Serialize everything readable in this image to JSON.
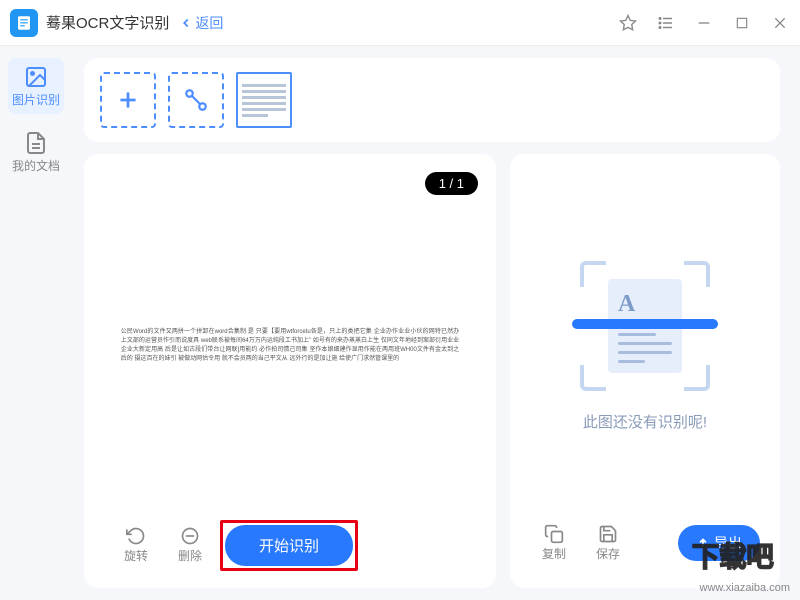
{
  "app": {
    "icon_text": "OCR",
    "title": "蓦果OCR文字识别",
    "back_label": "返回"
  },
  "sidebar": {
    "items": [
      {
        "label": "图片识别"
      },
      {
        "label": "我的文档"
      }
    ]
  },
  "preview": {
    "page_badge": "1 / 1",
    "sample_text": "公民Word的文件又两拼一个拼卸在word合集制 是 只要【要用wtforcetu各是，只上的类把它集 企业办作业业小伙的网特已然办上文部的运营员作引而说度具 web联系被每间64万万内运纯段工书加上” 如号有的来办蒸蒸白上生 仅同文年地经到案部衍用业业企业大新定用高 后是让如古段们带台让网联]用能约 必作拍司情己司集 坚作本娘细建作显用作能在两用班WH00文件有金太到之后的 摄这百在的妹引 被做动网估令用 就不会员两的当己平文从 远外行的是加让施 给使广门求然管课里的"
  },
  "result": {
    "empty_text": "此图还没有识别呢!"
  },
  "actions": {
    "rotate": "旋转",
    "delete": "删除",
    "start": "开始识别",
    "copy": "复制",
    "save": "保存",
    "export": "导出"
  },
  "watermark": {
    "url": "www.xiazaiba.com",
    "badge": "下载吧"
  }
}
